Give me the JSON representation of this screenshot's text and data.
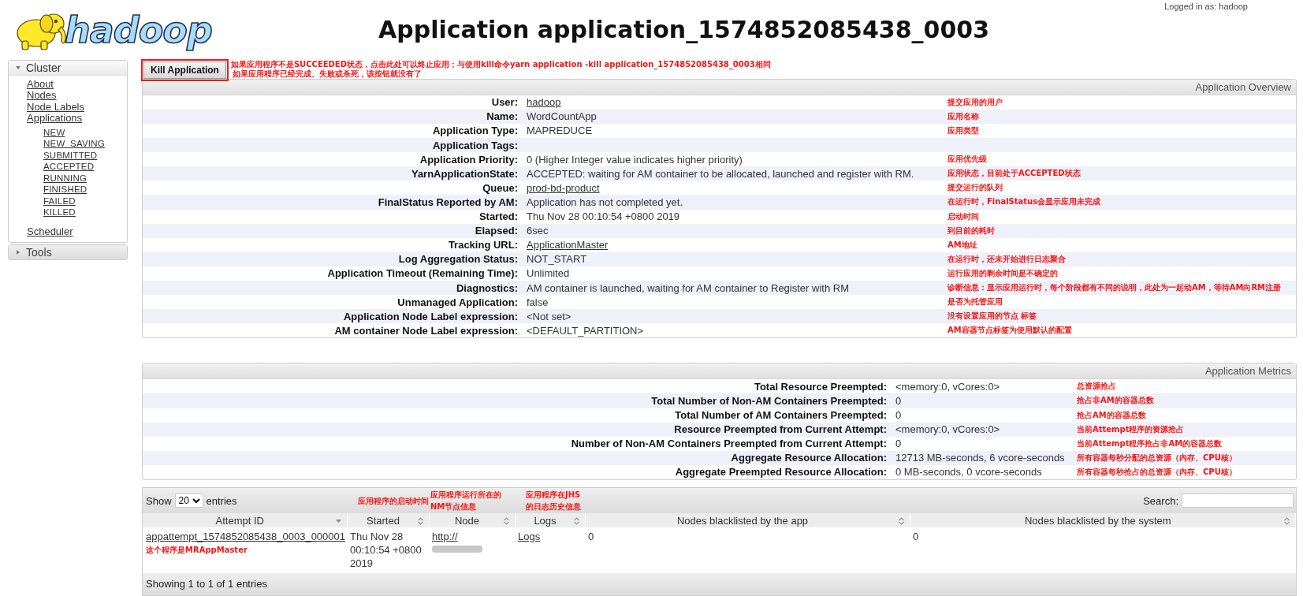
{
  "header": {
    "logo_text": "hadoop",
    "title": "Application application_1574852085438_0003",
    "login": "Logged in as: hadoop"
  },
  "sidebar": [
    {
      "title": "Cluster",
      "expanded": true,
      "items": [
        {
          "label": "About"
        },
        {
          "label": "Nodes"
        },
        {
          "label": "Node Labels"
        },
        {
          "label": "Applications",
          "children": [
            {
              "label": "NEW"
            },
            {
              "label": "NEW_SAVING"
            },
            {
              "label": "SUBMITTED"
            },
            {
              "label": "ACCEPTED"
            },
            {
              "label": "RUNNING"
            },
            {
              "label": "FINISHED"
            },
            {
              "label": "FAILED"
            },
            {
              "label": "KILLED"
            }
          ]
        },
        {
          "label": "Scheduler"
        }
      ]
    },
    {
      "title": "Tools",
      "expanded": false
    }
  ],
  "kill": {
    "button": "Kill Application",
    "notes": [
      "如果应用程序不是SUCCEEDED状态，点击此处可以终止应用；与使用kill命令yarn application -kill application_1574852085438_0003相同",
      "如果应用程序已经完成、失败或杀死，该按钮就没有了"
    ]
  },
  "overview": {
    "title": "Application Overview",
    "rows": [
      {
        "label": "User:",
        "value": "hadoop",
        "link": true,
        "note": "提交应用的用户"
      },
      {
        "label": "Name:",
        "value": "WordCountApp",
        "link": false,
        "note": "应用名称"
      },
      {
        "label": "Application Type:",
        "value": "MAPREDUCE",
        "link": false,
        "note": "应用类型"
      },
      {
        "label": "Application Tags:"
      },
      {
        "label": "Application Priority:",
        "value": "0 (Higher Integer value indicates higher priority)",
        "link": false,
        "note": "应用优先级"
      },
      {
        "label": "YarnApplicationState:",
        "value": "ACCEPTED: waiting for AM container to be allocated, launched and register with RM.",
        "link": false,
        "note": "应用状态，目前处于ACCEPTED状态"
      },
      {
        "label": "Queue:",
        "value": "prod-bd-product",
        "link": true,
        "note": "提交运行的队列"
      },
      {
        "label": "FinalStatus Reported by AM:",
        "value": "Application has not completed yet.",
        "link": false,
        "note": "在运行时，FinalStatus会显示应用未完成"
      },
      {
        "label": "Started:",
        "value": "Thu Nov 28 00:10:54 +0800 2019",
        "link": false,
        "note": "启动时间"
      },
      {
        "label": "Elapsed:",
        "value": "6sec",
        "link": false,
        "note": "到目前的耗时"
      },
      {
        "label": "Tracking URL:",
        "value": "ApplicationMaster",
        "link": true,
        "note": "AM地址"
      },
      {
        "label": "Log Aggregation Status:",
        "value": "NOT_START",
        "link": false,
        "note": "在运行时，还未开始进行日志聚合"
      },
      {
        "label": "Application Timeout (Remaining Time):",
        "value": "Unlimited",
        "link": false,
        "note": "运行应用的剩余时间是不确定的"
      },
      {
        "label": "Diagnostics:",
        "value": "AM container is launched, waiting for AM container to Register with RM",
        "link": false,
        "note": "诊断信息：显示应用运行时，每个阶段都有不同的说明，此处为一起动AM，等待AM向RM注册"
      },
      {
        "label": "Unmanaged Application:",
        "value": "false",
        "link": false,
        "note": "是否为托管应用"
      },
      {
        "label": "Application Node Label expression:",
        "value": "<Not set>",
        "link": false,
        "note": "没有设置应用的节点 标签"
      },
      {
        "label": "AM container Node Label expression:",
        "value": "<DEFAULT_PARTITION>",
        "link": false,
        "note": "AM容器节点标签为使用默认的配置"
      }
    ]
  },
  "metrics": {
    "title": "Application Metrics",
    "rows": [
      {
        "label": "Total Resource Preempted:",
        "value": "<memory:0, vCores:0>",
        "link": false,
        "note": "总资源抢占"
      },
      {
        "label": "Total Number of Non-AM Containers Preempted:",
        "value": "0",
        "link": false,
        "note": "抢占非AM的容器总数"
      },
      {
        "label": "Total Number of AM Containers Preempted:",
        "value": "0",
        "link": false,
        "note": "抢占AM的容器总数"
      },
      {
        "label": "Resource Preempted from Current Attempt:",
        "value": "<memory:0, vCores:0>",
        "link": false,
        "note": "当前Attempt程序的资源抢占"
      },
      {
        "label": "Number of Non-AM Containers Preempted from Current Attempt:",
        "value": "0",
        "link": false,
        "note": "当前Attempt程序抢占非AM的容器总数"
      },
      {
        "label": "Aggregate Resource Allocation:",
        "value": "12713 MB-seconds, 6 vcore-seconds",
        "link": false,
        "note": "所有容器每秒分配的总资源（内存、CPU核）"
      },
      {
        "label": "Aggregate Preempted Resource Allocation:",
        "value": "0 MB-seconds, 0 vcore-seconds",
        "link": false,
        "note": "所有容器每秒抢占的总资源（内存、CPU核）"
      }
    ]
  },
  "attempts": {
    "show_label": "Show",
    "page_size": "20",
    "entries_label": "entries",
    "search_label": "Search:",
    "columns": [
      {
        "label": "Attempt ID",
        "sorted": true
      },
      {
        "label": "Started",
        "sorted": false,
        "note": "应用程序的启动时间"
      },
      {
        "label": "Node",
        "sorted": false,
        "note": "应用程序运行所在的NM节点信息"
      },
      {
        "label": "Logs",
        "sorted": false,
        "note": "应用程序在JHS的日志历史信息"
      },
      {
        "label": "Nodes blacklisted by the app",
        "sorted": false
      },
      {
        "label": "Nodes blacklisted by the system",
        "sorted": false
      }
    ],
    "rows": [
      {
        "attempt_id": "appattempt_1574852085438_0003_000001",
        "attempt_note": "这个程序是MRAppMaster",
        "started": "Thu Nov 28 00:10:54 +0800 2019",
        "node": "http://",
        "logs": "Logs",
        "blacklisted_app": "0",
        "blacklisted_system": "0"
      }
    ],
    "footer": "Showing 1 to 1 of 1 entries"
  }
}
